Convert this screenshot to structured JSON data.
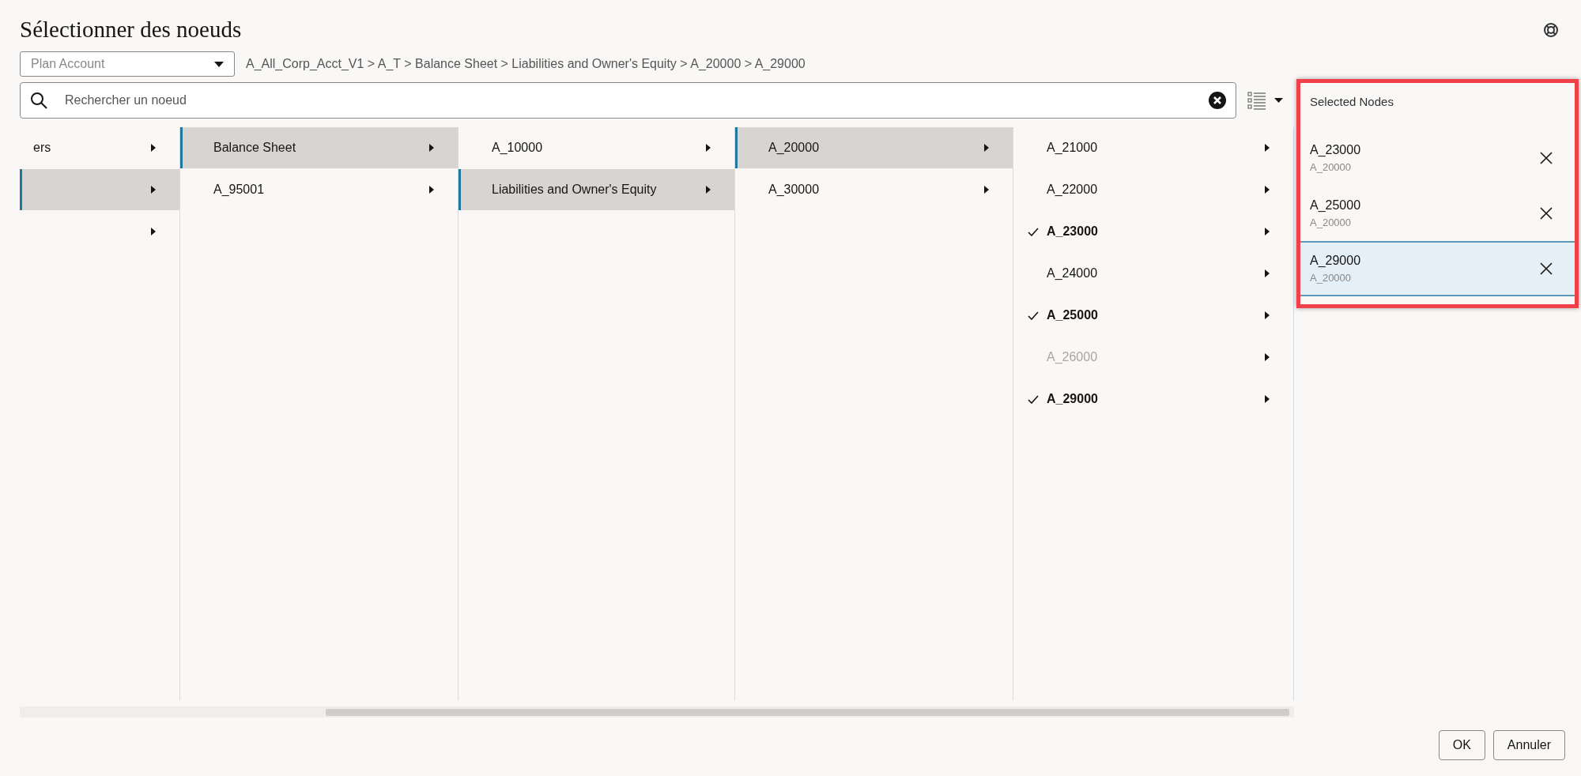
{
  "dialog": {
    "title": "Sélectionner des noeuds"
  },
  "dimension_select": {
    "placeholder": "Plan Account"
  },
  "breadcrumb": "A_All_Corp_Acct_V1 > A_T > Balance Sheet > Liabilities and Owner's Equity > A_20000 > A_29000",
  "search": {
    "placeholder": "Rechercher un noeud"
  },
  "columns": [
    {
      "items": [
        {
          "label": "ers",
          "selected": false
        },
        {
          "selected": true
        },
        {
          "selected": false
        }
      ]
    },
    {
      "items": [
        {
          "label": "Balance Sheet",
          "selected": true
        },
        {
          "label": "A_95001",
          "selected": false
        }
      ]
    },
    {
      "items": [
        {
          "label": "A_10000",
          "selected": false
        },
        {
          "label": "Liabilities and Owner's Equity",
          "selected": true
        }
      ]
    },
    {
      "items": [
        {
          "label": "A_20000",
          "selected": true
        },
        {
          "label": "A_30000",
          "selected": false
        }
      ]
    },
    {
      "items": [
        {
          "label": "A_21000",
          "selected": false,
          "checked": false,
          "disabled": false
        },
        {
          "label": "A_22000",
          "selected": false,
          "checked": false,
          "disabled": false
        },
        {
          "label": "A_23000",
          "selected": false,
          "checked": true,
          "disabled": false
        },
        {
          "label": "A_24000",
          "selected": false,
          "checked": false,
          "disabled": false
        },
        {
          "label": "A_25000",
          "selected": false,
          "checked": true,
          "disabled": false
        },
        {
          "label": "A_26000",
          "selected": false,
          "checked": false,
          "disabled": true
        },
        {
          "label": "A_29000",
          "selected": false,
          "checked": true,
          "disabled": false
        }
      ]
    }
  ],
  "selected_panel": {
    "title": "Selected Nodes",
    "items": [
      {
        "label": "A_23000",
        "parent": "A_20000",
        "selected": false
      },
      {
        "label": "A_25000",
        "parent": "A_20000",
        "selected": false
      },
      {
        "label": "A_29000",
        "parent": "A_20000",
        "selected": true
      }
    ]
  },
  "buttons": [
    "OK",
    "Annuler"
  ]
}
